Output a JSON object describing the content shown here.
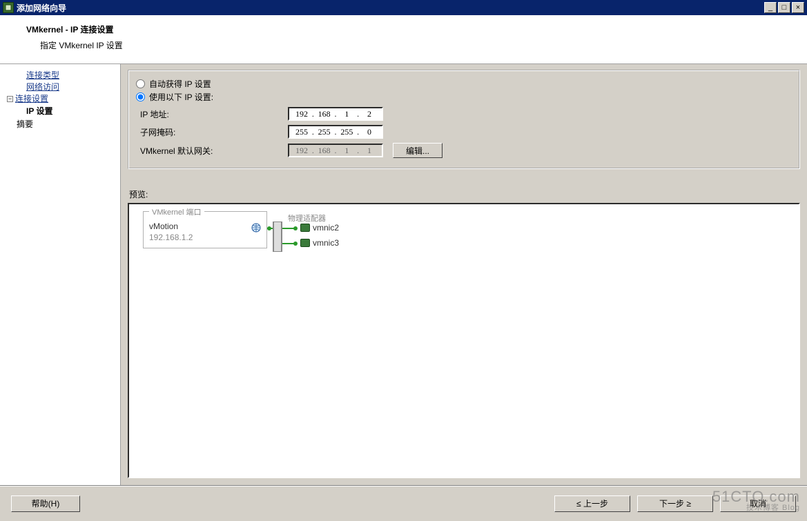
{
  "window": {
    "title": "添加网络向导",
    "minimize": "_",
    "maximize": "□",
    "close": "×"
  },
  "header": {
    "title": "VMkernel - IP 连接设置",
    "subtitle": "指定 VMkernel IP 设置"
  },
  "sidebar": {
    "item0": "连接类型",
    "item1": "网络访问",
    "item2": "连接设置",
    "item2_sub": "IP 设置",
    "item3": "摘要",
    "expander": "−"
  },
  "ip": {
    "radio_auto": "自动获得 IP 设置",
    "radio_manual": "使用以下 IP 设置:",
    "label_ip": "IP 地址:",
    "label_mask": "子网掩码:",
    "label_gw": "VMkernel 默认网关:",
    "ip_o1": "192",
    "ip_o2": "168",
    "ip_o3": "1",
    "ip_o4": "2",
    "mask_o1": "255",
    "mask_o2": "255",
    "mask_o3": "255",
    "mask_o4": "0",
    "gw_o1": "192",
    "gw_o2": "168",
    "gw_o3": "1",
    "gw_o4": "1",
    "edit_button": "编辑..."
  },
  "preview": {
    "label": "预览:",
    "portgroup_legend": "VMkernel 端口",
    "portgroup_name": "vMotion",
    "portgroup_ip": "192.168.1.2",
    "phys_label": "物理适配器",
    "nic1": "vmnic2",
    "nic2": "vmnic3"
  },
  "buttons": {
    "help": "帮助(H)",
    "back": "≤ 上一步",
    "next": "下一步 ≥",
    "cancel": "取消"
  },
  "watermark": {
    "line1": "51CTO.com",
    "line2": "技术博客  Blog"
  }
}
